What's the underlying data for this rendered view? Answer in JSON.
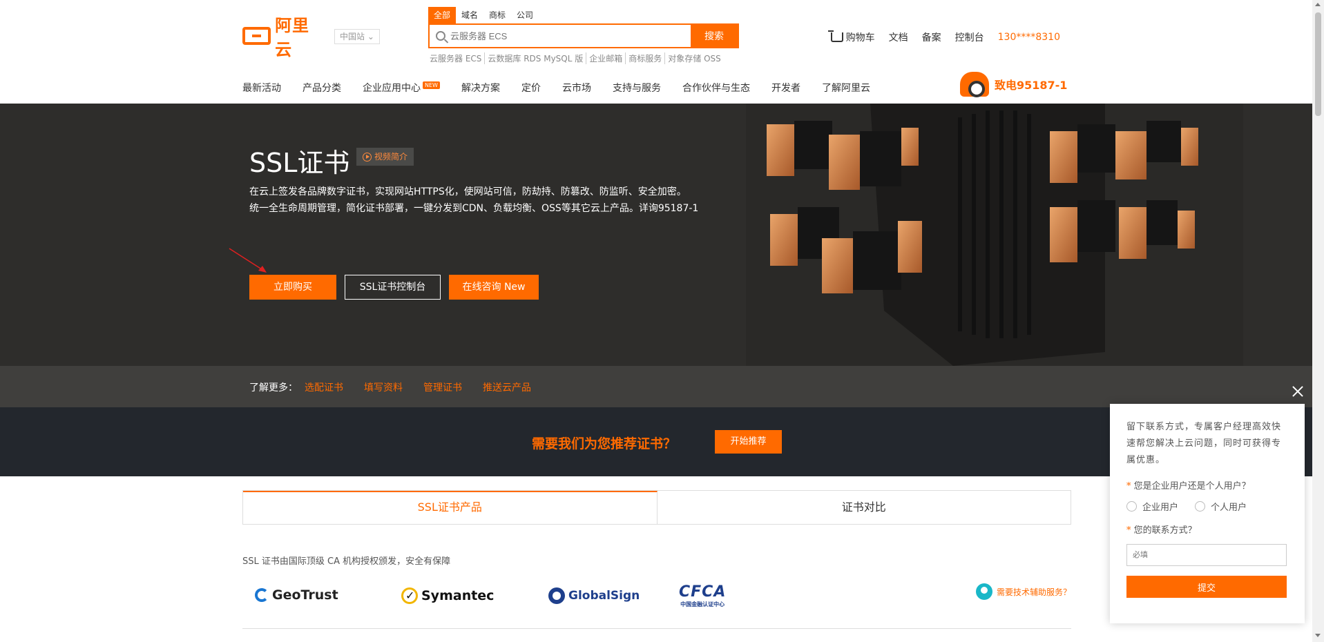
{
  "header": {
    "logo_text": "阿里云",
    "region": "中国站",
    "search_tabs": [
      "全部",
      "域名",
      "商标",
      "公司"
    ],
    "search_placeholder": "云服务器 ECS",
    "search_button": "搜索",
    "hot_words": [
      "云服务器 ECS",
      "云数据库 RDS MySQL 版",
      "企业邮箱",
      "商标服务",
      "对象存储 OSS"
    ],
    "links": {
      "cart": "购物车",
      "docs": "文档",
      "filing": "备案",
      "console": "控制台",
      "user": "130****8310"
    },
    "nav": [
      "最新活动",
      "产品分类",
      "企业应用中心",
      "解决方案",
      "定价",
      "云市场",
      "支持与服务",
      "合作伙伴与生态",
      "开发者",
      "了解阿里云"
    ],
    "nav_badge": "NEW",
    "hotline": "致电95187-1"
  },
  "banner": {
    "title": "SSL证书",
    "video_label": "视频简介",
    "desc_line1": "在云上签发各品牌数字证书，实现网站HTTPS化，使网站可信，防劫持、防篡改、防监听、安全加密。",
    "desc_line2": "统一全生命周期管理，简化证书部署，一键分发到CDN、负载均衡、OSS等其它云上产品。详询95187-1",
    "btn_buy": "立即购买",
    "btn_console": "SSL证书控制台",
    "btn_consult": "在线咨询 New"
  },
  "learn": {
    "label": "了解更多：",
    "links": [
      "选配证书",
      "填写资料",
      "管理证书",
      "推送云产品"
    ]
  },
  "recommend": {
    "text": "需要我们为您推荐证书？",
    "button": "开始推荐"
  },
  "tabs": [
    "SSL证书产品",
    "证书对比"
  ],
  "intro": "SSL 证书由国际顶级 CA 机构授权颁发，安全有保障",
  "brands": {
    "geotrust": "GeoTrust",
    "symantec": "Symantec",
    "globalsign": "GlobalSign",
    "cfca": "CFCA",
    "cfca_sub": "中国金融认证中心"
  },
  "tech_help": "需要技术辅助服务？",
  "popup": {
    "desc": "留下联系方式，专属客户经理高效快速帮您解决上云问题，同时可获得专属优惠。",
    "q_user_type": "您是企业用户还是个人用户？",
    "opt_enterprise": "企业用户",
    "opt_personal": "个人用户",
    "q_contact": "您的联系方式？",
    "contact_placeholder": "必填",
    "submit": "提交",
    "required_mark": "*"
  },
  "colors": {
    "accent": "#ff6a00",
    "banner_bg": "#2e2d2b",
    "recommend_bg": "#23272d"
  }
}
